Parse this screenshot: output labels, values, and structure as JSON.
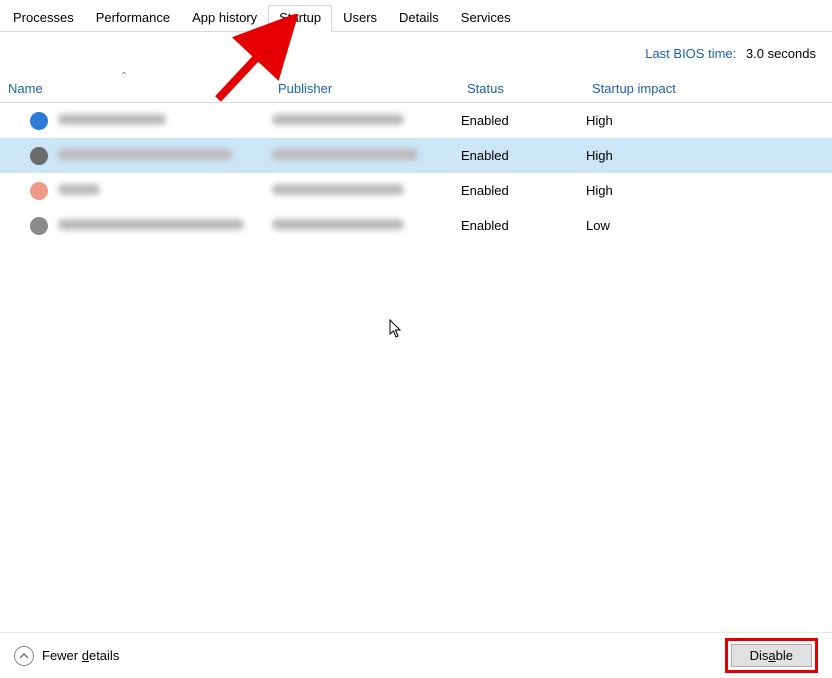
{
  "tabs": [
    {
      "label": "Processes",
      "active": false
    },
    {
      "label": "Performance",
      "active": false
    },
    {
      "label": "App history",
      "active": false
    },
    {
      "label": "Startup",
      "active": true
    },
    {
      "label": "Users",
      "active": false
    },
    {
      "label": "Details",
      "active": false
    },
    {
      "label": "Services",
      "active": false
    }
  ],
  "bios": {
    "label": "Last BIOS time:",
    "value": "3.0 seconds"
  },
  "columns": {
    "name": "Name",
    "publisher": "Publisher",
    "status": "Status",
    "impact": "Startup impact"
  },
  "rows": [
    {
      "icon_color": "#2e7cd6",
      "selected": false,
      "status": "Enabled",
      "impact": "High",
      "name_blur_w": 108,
      "pub_blur_w": 132
    },
    {
      "icon_color": "#6b6b6b",
      "selected": true,
      "status": "Enabled",
      "impact": "High",
      "name_blur_w": 174,
      "pub_blur_w": 146
    },
    {
      "icon_color": "#f09a8a",
      "selected": false,
      "status": "Enabled",
      "impact": "High",
      "name_blur_w": 42,
      "pub_blur_w": 132
    },
    {
      "icon_color": "#8a8a8a",
      "selected": false,
      "status": "Enabled",
      "impact": "Low",
      "name_blur_w": 186,
      "pub_blur_w": 132
    }
  ],
  "footer": {
    "fewer": "Fewer details",
    "disable": "Disable"
  },
  "annotations": {
    "arrow_color": "#e40000"
  }
}
